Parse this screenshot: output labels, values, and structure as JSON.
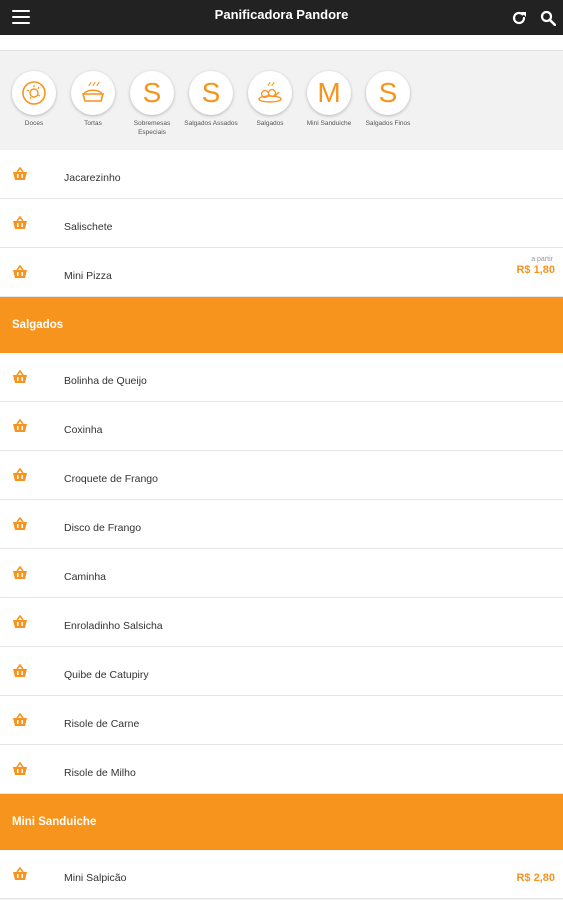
{
  "header": {
    "title": "Panificadora Pandore",
    "menu_icon": "menu-icon",
    "refresh_icon": "refresh-icon",
    "search_icon": "search-icon"
  },
  "categories": [
    {
      "label": "Doces",
      "icon": "donut-icon",
      "letter": ""
    },
    {
      "label": "Tortas",
      "icon": "pie-icon",
      "letter": ""
    },
    {
      "label": "Sobremesas Especiais",
      "icon": "letter-icon",
      "letter": "S"
    },
    {
      "label": "Salgados Assados",
      "icon": "letter-icon",
      "letter": "S"
    },
    {
      "label": "Salgados",
      "icon": "savory-icon",
      "letter": ""
    },
    {
      "label": "Mini Sanduiche",
      "icon": "letter-icon",
      "letter": "M"
    },
    {
      "label": "Salgados Finos",
      "icon": "letter-icon",
      "letter": "S"
    }
  ],
  "rows_top": [
    {
      "name": "Jacarezinho"
    },
    {
      "name": "Salischete"
    },
    {
      "name": "Mini Pizza",
      "prefix": "a partir",
      "price": "R$ 1,80"
    }
  ],
  "section_salgados": {
    "title": "Salgados"
  },
  "rows_salgados": [
    {
      "name": "Bolinha de Queijo"
    },
    {
      "name": "Coxinha"
    },
    {
      "name": "Croquete de Frango"
    },
    {
      "name": "Disco de Frango"
    },
    {
      "name": "Caminha"
    },
    {
      "name": "Enroladinho Salsicha"
    },
    {
      "name": "Quibe de Catupiry"
    },
    {
      "name": "Risole de Carne"
    },
    {
      "name": "Risole de Milho"
    }
  ],
  "section_mini": {
    "title": "Mini Sanduiche"
  },
  "rows_mini": [
    {
      "name": "Mini Salpicão",
      "price": "R$ 2,80"
    }
  ],
  "colors": {
    "accent": "#f7941d",
    "topbar": "#222222"
  }
}
